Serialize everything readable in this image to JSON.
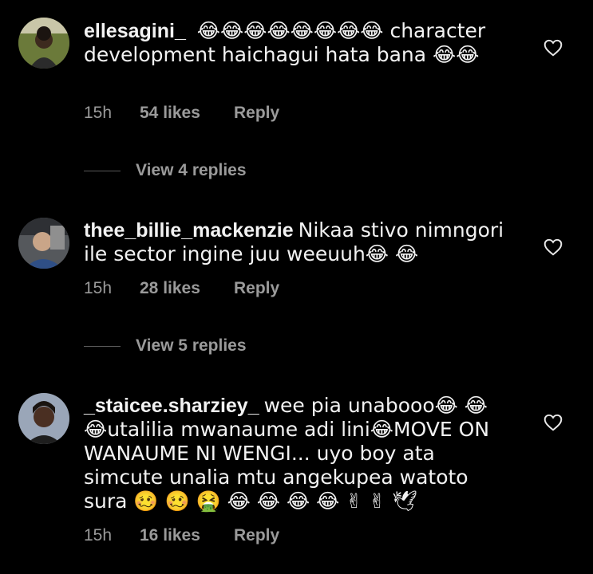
{
  "comments": [
    {
      "username": "ellesagini_",
      "text": " 😂😂😂😂😂😂😂😂 character development haichagui hata bana 😂😂",
      "time": "15h",
      "likes": "54 likes",
      "reply": "Reply",
      "view_replies": "View 4 replies",
      "avatar": "avatar-woman-outdoors",
      "liked": false
    },
    {
      "username": "thee_billie_mackenzie",
      "text": "Nikaa stivo nimngori ile sector ingine juu weeuuh😂 😂",
      "time": "15h",
      "likes": "28 likes",
      "reply": "Reply",
      "view_replies": "View 5 replies",
      "avatar": "avatar-person-in-car",
      "liked": false
    },
    {
      "username": "_staicee.sharziey_",
      "text": "wee pia unabooo😂 😂 😂utalilia mwanaume adi lini😂MOVE ON WANAUME NI WENGI... uyo boy ata simcute unalia mtu angekupea watoto sura 🥴 🥴 🤮 😂 😂 😂 😂 ✌ ✌ 🕊",
      "time": "15h",
      "likes": "16 likes",
      "reply": "Reply",
      "avatar": "avatar-woman-smiling",
      "liked": false
    }
  ],
  "colors": {
    "background": "#000000",
    "text": "#f2f2f2",
    "meta": "#9a9a9a"
  },
  "icons": {
    "like": "heart-outline-icon"
  }
}
